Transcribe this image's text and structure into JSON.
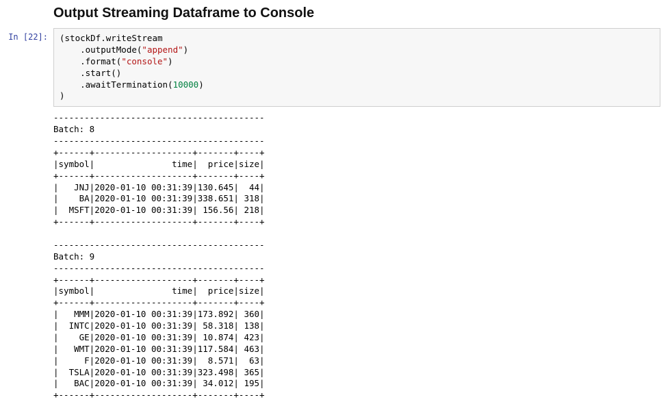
{
  "heading": "Output Streaming Dataframe to Console",
  "prompt": {
    "label": "In [22]:"
  },
  "code": {
    "l1": "(stockDf.writeStream",
    "l2a": "    .outputMode(",
    "l2s": "\"append\"",
    "l2b": ")",
    "l3a": "    .format(",
    "l3s": "\"console\"",
    "l3b": ")",
    "l4": "    .start()",
    "l5a": "    .awaitTermination(",
    "l5n": "10000",
    "l5b": ")",
    "l6": ")"
  },
  "output": {
    "batches": [
      {
        "batch_no": 8,
        "columns": [
          "symbol",
          "time",
          "price",
          "size"
        ],
        "rows": [
          {
            "symbol": "JNJ",
            "time": "2020-01-10 00:31:39",
            "price": "130.645",
            "size": 44
          },
          {
            "symbol": "BA",
            "time": "2020-01-10 00:31:39",
            "price": "338.651",
            "size": 318
          },
          {
            "symbol": "MSFT",
            "time": "2020-01-10 00:31:39",
            "price": " 156.56",
            "size": 218
          }
        ]
      },
      {
        "batch_no": 9,
        "columns": [
          "symbol",
          "time",
          "price",
          "size"
        ],
        "rows": [
          {
            "symbol": "MMM",
            "time": "2020-01-10 00:31:39",
            "price": "173.892",
            "size": 360
          },
          {
            "symbol": "INTC",
            "time": "2020-01-10 00:31:39",
            "price": " 58.318",
            "size": 138
          },
          {
            "symbol": "GE",
            "time": "2020-01-10 00:31:39",
            "price": " 10.874",
            "size": 423
          },
          {
            "symbol": "WMT",
            "time": "2020-01-10 00:31:39",
            "price": "117.584",
            "size": 463
          },
          {
            "symbol": "F",
            "time": "2020-01-10 00:31:39",
            "price": "  8.571",
            "size": 63
          },
          {
            "symbol": "TSLA",
            "time": "2020-01-10 00:31:39",
            "price": "323.498",
            "size": 365
          },
          {
            "symbol": "BAC",
            "time": "2020-01-10 00:31:39",
            "price": " 34.012",
            "size": 195
          }
        ]
      }
    ]
  }
}
